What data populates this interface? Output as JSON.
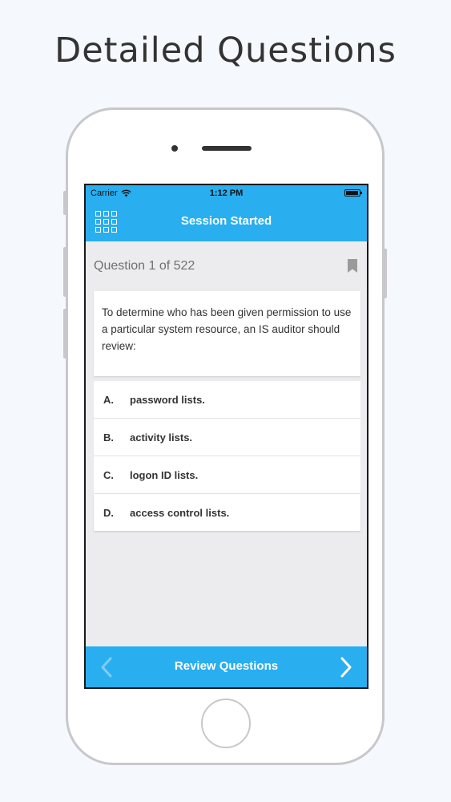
{
  "promo": {
    "title": "Detailed Questions"
  },
  "status_bar": {
    "carrier": "Carrier",
    "time": "1:12 PM"
  },
  "nav": {
    "title": "Session Started",
    "menu_icon": "grid-icon"
  },
  "question": {
    "header": "Question 1 of 522",
    "text": "To determine who has been given permission to use a particular system resource, an IS auditor should review:",
    "bookmark_icon": "bookmark-icon"
  },
  "options": [
    {
      "letter": "A.",
      "text": "password lists."
    },
    {
      "letter": "B.",
      "text": "activity lists."
    },
    {
      "letter": "C.",
      "text": "logon ID lists."
    },
    {
      "letter": "D.",
      "text": "access control lists."
    }
  ],
  "bottom_bar": {
    "title": "Review Questions",
    "prev_icon": "chevron-left-icon",
    "next_icon": "chevron-right-icon"
  },
  "colors": {
    "accent": "#29aef0",
    "background": "#ececee",
    "page_background": "#f5f8fc"
  }
}
